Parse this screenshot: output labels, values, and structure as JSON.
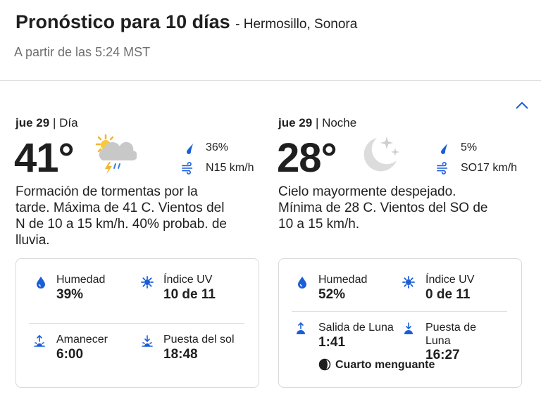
{
  "header": {
    "title": "Pronóstico para 10 días",
    "location": "- Hermosillo, Sonora",
    "updated": "A partir de las 5:24 MST"
  },
  "colors": {
    "accent": "#1a5ed8",
    "border": "#d9d9d9",
    "muted": "#6f6f6f"
  },
  "day": {
    "date": "jue 29",
    "period": "| Día",
    "temp": "41°",
    "icon": "thunderstorm-partly-sunny-icon",
    "rain": "36%",
    "wind": "N15 km/h",
    "description": "Formación de tormentas por la tarde. Máxima de 41 C. Vientos del N de 10 a 15 km/h. 40% probab. de lluvia.",
    "details": {
      "humidity_label": "Humedad",
      "humidity_value": "39%",
      "uv_label": "Índice UV",
      "uv_value": "10 de 11",
      "rise_label": "Amanecer",
      "rise_value": "6:00",
      "set_label": "Puesta del sol",
      "set_value": "18:48"
    }
  },
  "night": {
    "date": "jue 29",
    "period": "| Noche",
    "temp": "28°",
    "icon": "clear-night-moon-icon",
    "rain": "5%",
    "wind": "SO17 km/h",
    "description": "Cielo mayormente despejado. Mínima de 28 C. Vientos del SO de 10 a 15 km/h.",
    "details": {
      "humidity_label": "Humedad",
      "humidity_value": "52%",
      "uv_label": "Índice UV",
      "uv_value": "0 de 11",
      "rise_label": "Salida de Luna",
      "rise_value": "1:41",
      "set_label": "Puesta de Luna",
      "set_value": "16:27",
      "phase": "Cuarto menguante"
    }
  }
}
